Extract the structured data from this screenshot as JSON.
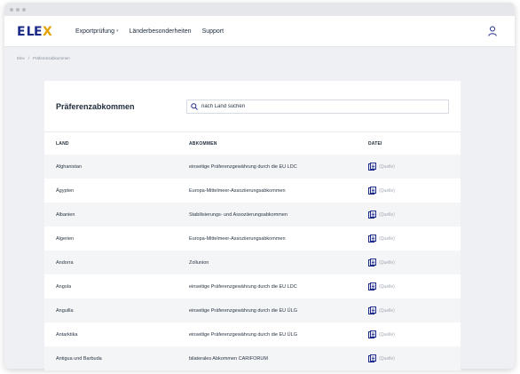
{
  "nav": {
    "logo": "ELEX",
    "items": [
      {
        "label": "Exportprüfung",
        "has_dropdown": true
      },
      {
        "label": "Länderbesonderheiten",
        "has_dropdown": false
      },
      {
        "label": "Support",
        "has_dropdown": false
      }
    ]
  },
  "breadcrumb": {
    "home": "Elex",
    "separator": "/",
    "current": "Präferenzabkommen"
  },
  "page": {
    "title": "Präferenzabkommen",
    "search_placeholder": "nach Land suchen"
  },
  "table": {
    "columns": [
      "LAND",
      "ABKOMMEN",
      "DATEI"
    ],
    "rows": [
      {
        "land": "Afghanistan",
        "abkommen": "einseitige Präferenzgewährung durch die EU LDC",
        "datei": "(Quelle)"
      },
      {
        "land": "Ägypten",
        "abkommen": "Europa-Mittelmeer-Assoziierungsabkommen",
        "datei": "(Quelle)"
      },
      {
        "land": "Albanien",
        "abkommen": "Stabilisierungs- und Assoziierungsabkommen",
        "datei": "(Quelle)"
      },
      {
        "land": "Algerien",
        "abkommen": "Europa-Mittelmeer-Assoziierungsabkommen",
        "datei": "(Quelle)"
      },
      {
        "land": "Andorra",
        "abkommen": "Zollunion",
        "datei": "(Quelle)"
      },
      {
        "land": "Angola",
        "abkommen": "einseitige Präferenzgewährung durch die EU LDC",
        "datei": "(Quelle)"
      },
      {
        "land": "Anguilla",
        "abkommen": "einseitige Präferenzgewährung durch die EU ÜLG",
        "datei": "(Quelle)"
      },
      {
        "land": "Antarktika",
        "abkommen": "einseitige Präferenzgewährung durch die EU ÜLG",
        "datei": "(Quelle)"
      },
      {
        "land": "Antigua und Barbuda",
        "abkommen": "bilaterales Abkommen CARIFORUM",
        "datei": "(Quelle)"
      }
    ]
  },
  "colors": {
    "brand": "#1c2a8a",
    "accent": "#e2a300",
    "row_alt": "#f4f5f7"
  }
}
